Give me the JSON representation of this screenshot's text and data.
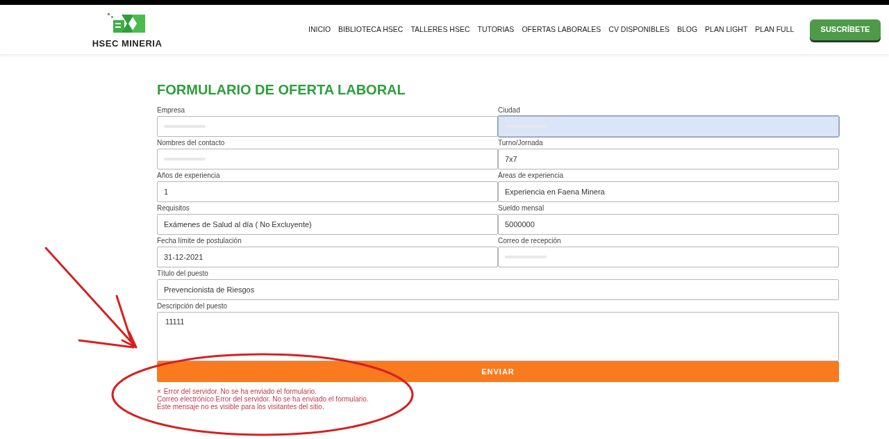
{
  "header": {
    "logo_text": "HSEC MINERIA",
    "nav": [
      "INICIO",
      "BIBLIOTECA HSEC",
      "TALLERES HSEC",
      "TUTORIAS",
      "OFERTAS LABORALES",
      "CV DISPONIBLES",
      "BLOG",
      "PLAN LIGHT",
      "PLAN FULL"
    ],
    "subscribe_button": "SUSCRÍBETE"
  },
  "form": {
    "title": "FORMULARIO DE OFERTA LABORAL",
    "fields": [
      {
        "label": "Empresa",
        "redacted": true,
        "focused": false,
        "wide": false
      },
      {
        "label": "Ciudad",
        "redacted": true,
        "focused": true,
        "wide": false
      },
      {
        "label": "Nombres del contacto",
        "redacted": true,
        "focused": false,
        "wide": false
      },
      {
        "label": "Turno/Jornada",
        "value": "7x7",
        "focused": false,
        "wide": false
      },
      {
        "label": "Años de experiencia",
        "value": "1",
        "focused": false,
        "wide": false
      },
      {
        "label": "Áreas de experiencia",
        "value": "Experiencia en Faena Minera",
        "focused": false,
        "wide": false
      },
      {
        "label": "Requisitos",
        "value": "Exámenes de Salud al día ( No Excluyente)",
        "focused": false,
        "wide": false
      },
      {
        "label": "Sueldo mensal",
        "value": "5000000",
        "focused": false,
        "wide": false
      },
      {
        "label": "Fecha límite de postulación",
        "value": "31-12-2021",
        "focused": false,
        "wide": false
      },
      {
        "label": "Correo de recepción",
        "redacted": true,
        "focused": false,
        "wide": false
      },
      {
        "label": "Título del puesto",
        "value": "Prevencionista de Riesgos",
        "focused": false,
        "wide": true
      }
    ],
    "description": {
      "label": "Descripción del puesto",
      "value": "11111"
    },
    "submit": "ENVIAR",
    "error_icon": "×",
    "errors": [
      "Error del servidor. No se ha enviado el formulario.",
      "Correo electrónico Error del servidor. No se ha enviado el formulario.",
      "Este mensaje no es visible para los visitantes del sitio."
    ]
  },
  "annotations": [
    {
      "kind": "arrow"
    },
    {
      "kind": "arrow"
    },
    {
      "kind": "ellipse"
    }
  ]
}
